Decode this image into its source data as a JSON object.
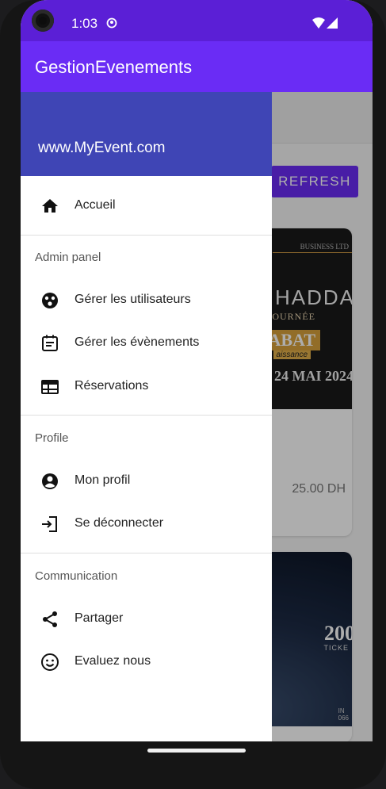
{
  "status_bar": {
    "time": "1:03"
  },
  "app_bar": {
    "title": "GestionEvenements"
  },
  "background": {
    "refresh_label": "REFRESH",
    "card1": {
      "img_line1": "BUSINESS LTD",
      "img_line2": "HADDA",
      "img_line3": "OURNÉE",
      "img_line4": "ABAT",
      "img_line5": "aissance",
      "img_line6": "24 MAI 2024",
      "price": "25.00 DH"
    },
    "card2": {
      "img_num": "200",
      "img_sub": "TICKE",
      "img_corner": "IN\n066"
    }
  },
  "drawer": {
    "header_site": "www.MyEvent.com",
    "home": {
      "label": "Accueil",
      "icon": "home-icon"
    },
    "sections": [
      {
        "title": "Admin panel",
        "items": [
          {
            "label": "Gérer les utilisateurs",
            "icon": "users-icon"
          },
          {
            "label": "Gérer les évènements",
            "icon": "events-icon"
          },
          {
            "label": "Réservations",
            "icon": "reservations-icon"
          }
        ]
      },
      {
        "title": "Profile",
        "items": [
          {
            "label": "Mon profil",
            "icon": "profile-icon"
          },
          {
            "label": "Se déconnecter",
            "icon": "logout-icon"
          }
        ]
      },
      {
        "title": "Communication",
        "items": [
          {
            "label": "Partager",
            "icon": "share-icon"
          },
          {
            "label": "Evaluez nous",
            "icon": "smiley-icon"
          }
        ]
      }
    ]
  },
  "colors": {
    "status_bar": "#5b1fd6",
    "app_bar": "#6a2cf5",
    "drawer_header": "#3f45b5",
    "accent_button": "#6a2cf5"
  }
}
